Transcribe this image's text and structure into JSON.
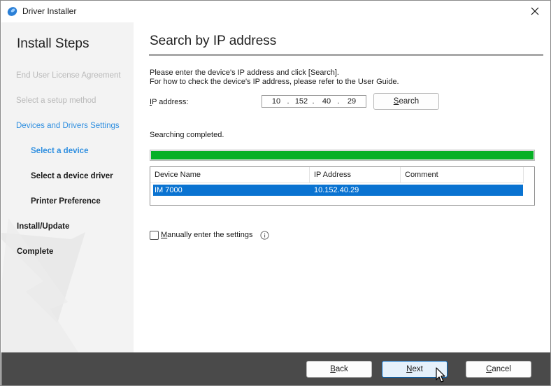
{
  "window": {
    "title": "Driver Installer"
  },
  "sidebar": {
    "title": "Install Steps",
    "steps": [
      {
        "label": "End User License Agreement"
      },
      {
        "label": "Select a setup method"
      },
      {
        "label": "Devices and Drivers Settings"
      },
      {
        "label": "Select a device"
      },
      {
        "label": "Select a device driver"
      },
      {
        "label": "Printer Preference"
      },
      {
        "label": "Install/Update"
      },
      {
        "label": "Complete"
      }
    ]
  },
  "main": {
    "title": "Search by IP address",
    "instruction_line1": "Please enter the device's IP address and click [Search].",
    "instruction_line2": "For how to check the device's IP address, please refer to the User Guide.",
    "ip_label_accel": "I",
    "ip_label_rest": "P address:",
    "ip_octets": [
      "10",
      "152",
      "40",
      "29"
    ],
    "search_button": {
      "accel": "S",
      "rest": "earch"
    },
    "status": "Searching completed.",
    "progress_percent": 100,
    "table": {
      "columns": [
        "Device Name",
        "IP Address",
        "Comment"
      ],
      "rows": [
        {
          "device_name": "IM 7000",
          "ip_address": "10.152.40.29",
          "comment": ""
        }
      ]
    },
    "manual_checkbox": {
      "accel": "M",
      "rest": "anually enter the settings",
      "checked": false
    }
  },
  "footer": {
    "back": {
      "accel": "B",
      "rest": "ack"
    },
    "next": {
      "accel": "N",
      "rest": "ext"
    },
    "cancel": {
      "accel": "C",
      "rest": "ancel"
    }
  },
  "colors": {
    "accent_blue": "#2f8fe0",
    "selection_blue": "#0a73d1",
    "progress_green": "#06b025",
    "footer_bg": "#4a4a4a"
  },
  "icons": {
    "app": "driver-installer-icon",
    "close": "close-icon",
    "info": "info-icon"
  }
}
